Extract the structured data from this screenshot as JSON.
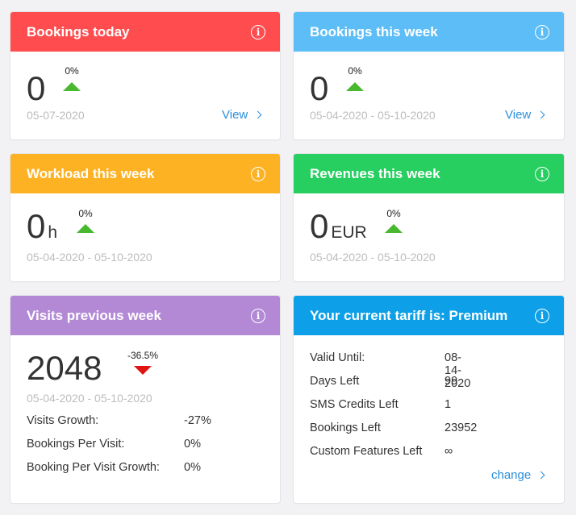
{
  "colors": {
    "red": "#ff4d4f",
    "light_blue": "#5cbdf7",
    "orange": "#fdb224",
    "green": "#26cf60",
    "purple": "#b389d6",
    "blue": "#0da0e8",
    "up_arrow": "#48b82e",
    "down_arrow": "#e11414",
    "link": "#2a8fdc"
  },
  "cards": {
    "bookings_today": {
      "title": "Bookings today",
      "value": "0",
      "change": "0%",
      "date": "05-07-2020",
      "link": "View",
      "icon": "info-icon"
    },
    "bookings_week": {
      "title": "Bookings this week",
      "value": "0",
      "change": "0%",
      "date": "05-04-2020 - 05-10-2020",
      "link": "View",
      "icon": "info-icon"
    },
    "workload_week": {
      "title": "Workload this week",
      "value": "0",
      "unit": "h",
      "change": "0%",
      "date": "05-04-2020 - 05-10-2020",
      "icon": "info-icon"
    },
    "revenues_week": {
      "title": "Revenues this week",
      "value": "0",
      "unit": "EUR",
      "change": "0%",
      "date": "05-04-2020 - 05-10-2020",
      "icon": "info-icon"
    },
    "visits_prev_week": {
      "title": "Visits previous week",
      "value": "2048",
      "change": "-36.5%",
      "date": "05-04-2020 - 05-10-2020",
      "icon": "info-icon",
      "stats": [
        {
          "label": "Visits Growth:",
          "value": "-27%"
        },
        {
          "label": "Bookings Per Visit:",
          "value": "0%"
        },
        {
          "label": "Booking Per Visit Growth:",
          "value": "0%"
        }
      ]
    },
    "tariff": {
      "title": "Your current tariff is: Premium",
      "icon": "info-icon",
      "link": "change",
      "stats": [
        {
          "label": "Valid Until:",
          "value": "08-14-2020"
        },
        {
          "label": "Days Left",
          "value": "99"
        },
        {
          "label": "SMS Credits Left",
          "value": "1"
        },
        {
          "label": "Bookings Left",
          "value": "23952"
        },
        {
          "label": "Custom Features Left",
          "value": "∞"
        }
      ]
    }
  }
}
